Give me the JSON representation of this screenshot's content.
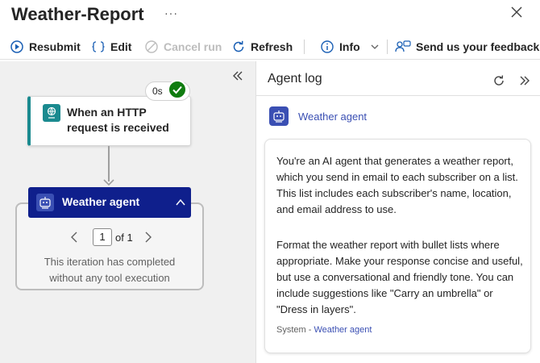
{
  "header": {
    "title": "Weather-Report",
    "more_icon": "ellipsis-icon",
    "close_icon": "close-icon"
  },
  "toolbar": {
    "resubmit": "Resubmit",
    "edit": "Edit",
    "cancel_run": "Cancel run",
    "refresh": "Refresh",
    "info": "Info",
    "feedback": "Send us your feedback"
  },
  "canvas": {
    "trigger": {
      "label": "When an HTTP request is received",
      "status_time": "0s",
      "status": "succeeded"
    },
    "agent": {
      "label": "Weather agent",
      "page_current": "1",
      "page_total_label": "of 1",
      "iteration_message": "This iteration has completed without any tool execution"
    }
  },
  "agent_log": {
    "title": "Agent log",
    "agent_name": "Weather agent",
    "message_paragraph_1": "You're an AI agent that generates a weather report, which you send in email to each subscriber on a list. This list includes each subscriber's name, location, and email address to use.",
    "message_paragraph_2": "Format the weather report with bullet lists where appropriate. Make your response concise and useful, but use a conversational and friendly tone. You can include suggestions like \"Carry an umbrella\" or \"Dress in layers\".",
    "footer_role": "System",
    "footer_sep": " - ",
    "footer_agent": "Weather agent"
  },
  "colors": {
    "accent": "#0f1f8c",
    "teal": "#1a8a8f",
    "success": "#107c10",
    "link": "#3a4fb3"
  }
}
